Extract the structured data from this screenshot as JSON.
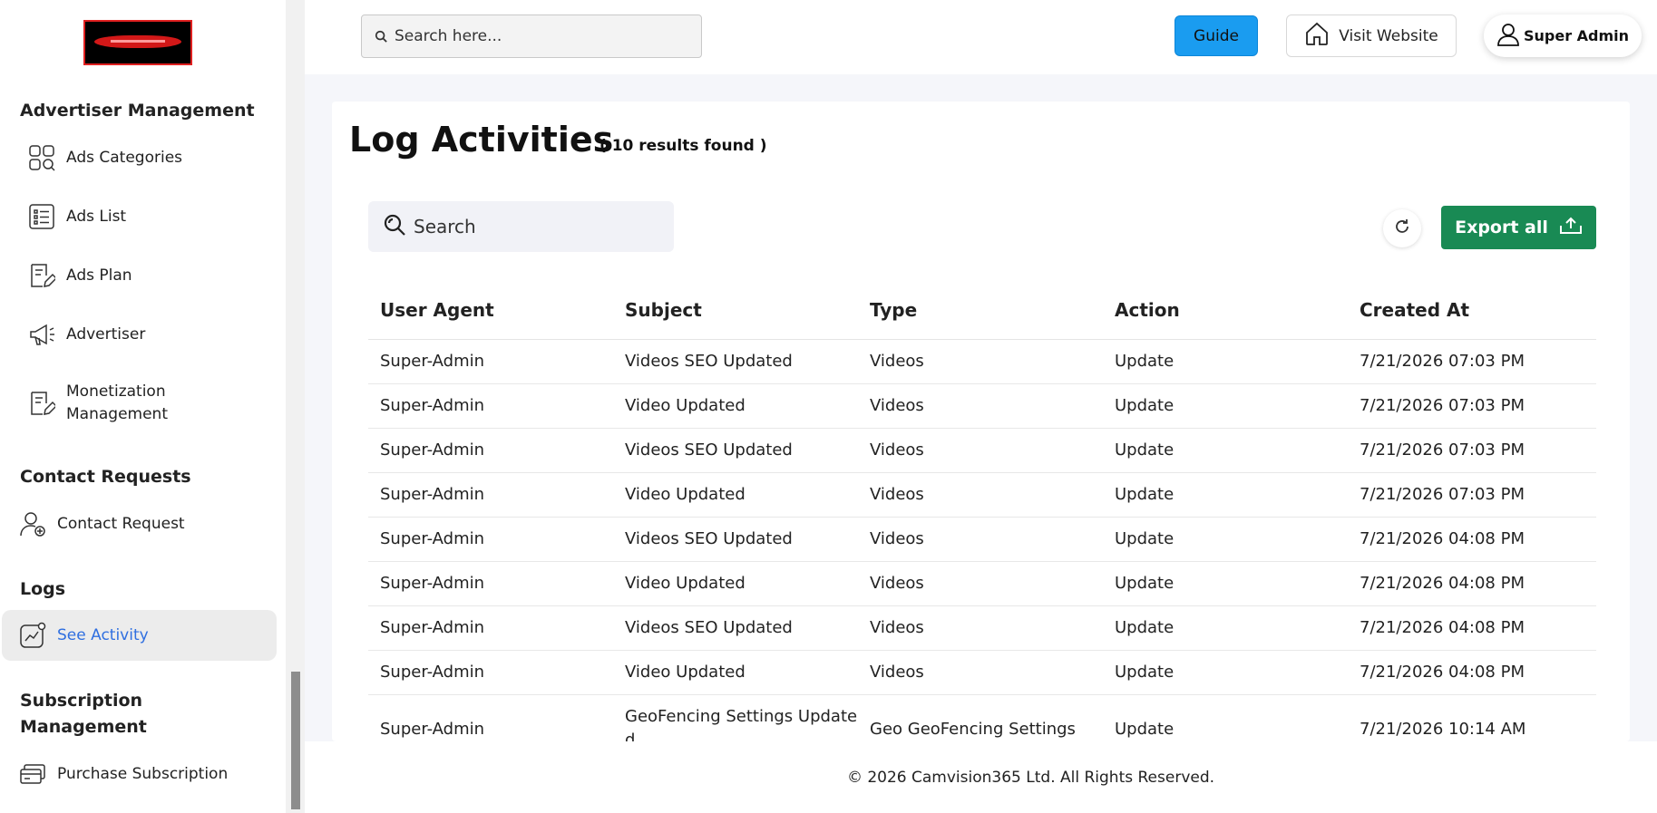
{
  "sidebar": {
    "sections": {
      "advertiser": "Advertiser Management",
      "contact": "Contact Requests",
      "logs": "Logs",
      "subscription": "Subscription Management"
    },
    "items": {
      "ads_categories": {
        "label": "Ads Categories",
        "icon": "grid-search-icon"
      },
      "ads_list": {
        "label": "Ads List",
        "icon": "list-icon"
      },
      "ads_plan": {
        "label": "Ads Plan",
        "icon": "document-edit-icon"
      },
      "advertiser": {
        "label": "Advertiser",
        "icon": "megaphone-icon"
      },
      "monetization": {
        "label": "Monetization Management",
        "icon": "document-edit-icon"
      },
      "contact_request": {
        "label": "Contact Request",
        "icon": "user-add-icon"
      },
      "see_activity": {
        "label": "See Activity",
        "icon": "activity-chart-icon"
      },
      "purchase_subscription": {
        "label": "Purchase Subscription",
        "icon": "credit-card-icon"
      }
    }
  },
  "topbar": {
    "search_placeholder": "Search here...",
    "guide_label": "Guide",
    "visit_label": "Visit Website",
    "admin_label": "Super Admin"
  },
  "main": {
    "title": "Log Activities",
    "results": "( 10 results found )",
    "search_placeholder": "Search",
    "export_label": "Export all"
  },
  "table": {
    "headers": [
      "User Agent",
      "Subject",
      "Type",
      "Action",
      "Created At"
    ],
    "rows": [
      [
        "Super-Admin",
        "Videos SEO Updated",
        "Videos",
        "Update",
        "7/21/2026 07:03 PM"
      ],
      [
        "Super-Admin",
        "Video Updated",
        "Videos",
        "Update",
        "7/21/2026 07:03 PM"
      ],
      [
        "Super-Admin",
        "Videos SEO Updated",
        "Videos",
        "Update",
        "7/21/2026 07:03 PM"
      ],
      [
        "Super-Admin",
        "Video Updated",
        "Videos",
        "Update",
        "7/21/2026 07:03 PM"
      ],
      [
        "Super-Admin",
        "Videos SEO Updated",
        "Videos",
        "Update",
        "7/21/2026 04:08 PM"
      ],
      [
        "Super-Admin",
        "Video Updated",
        "Videos",
        "Update",
        "7/21/2026 04:08 PM"
      ],
      [
        "Super-Admin",
        "Videos SEO Updated",
        "Videos",
        "Update",
        "7/21/2026 04:08 PM"
      ],
      [
        "Super-Admin",
        "Video Updated",
        "Videos",
        "Update",
        "7/21/2026 04:08 PM"
      ],
      [
        "Super-Admin",
        "GeoFencing Settings Updated",
        "Geo GeoFencing Settings",
        "Update",
        "7/21/2026 10:14 AM"
      ]
    ]
  },
  "footer": {
    "text": "© 2026 Camvision365 Ltd. All Rights Reserved."
  },
  "colors": {
    "accent_blue": "#1a9cf0",
    "export_green": "#198a54",
    "active_link": "#2f6fe0"
  }
}
